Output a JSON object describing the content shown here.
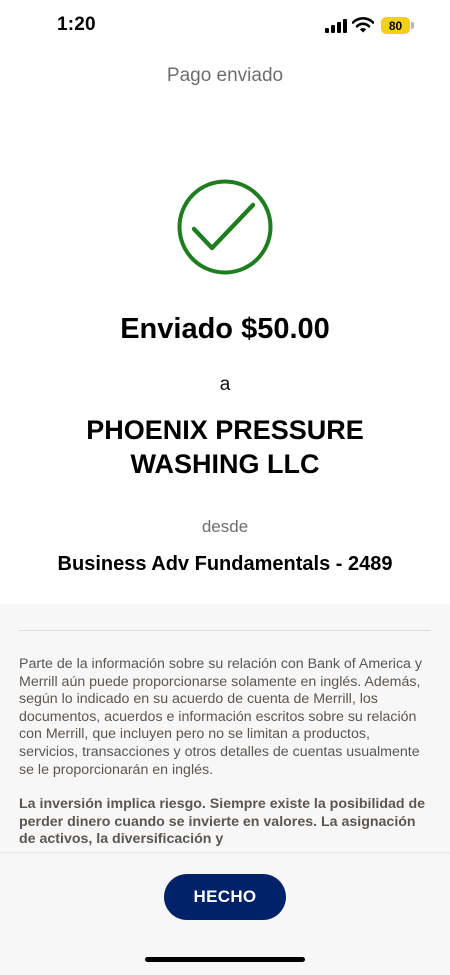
{
  "status_bar": {
    "time": "1:20",
    "battery_level": "80",
    "signal_icon": "cellular-signal-icon",
    "wifi_icon": "wifi-icon",
    "battery_color": "#f4d117"
  },
  "header": {
    "title": "Pago enviado"
  },
  "confirmation": {
    "icon": "checkmark-circle-icon",
    "icon_color": "#1e7d1e",
    "sent_label": "Enviado $50.00",
    "to_word": "a",
    "recipient_line1": "PHOENIX PRESSURE",
    "recipient_line2": "WASHING LLC",
    "from_word": "desde",
    "account": "Business Adv Fundamentals - 2489"
  },
  "disclosure": {
    "paragraph": "Parte de la información sobre su relación con Bank of America y Merrill aún puede proporcionarse solamente en inglés. Además, según lo indicado en su acuerdo de cuenta de Merrill, los documentos, acuerdos e información escritos sobre su relación con Merrill, que incluyen pero no se limitan a productos, servicios, transacciones y otros detalles de cuentas usualmente se le proporcionarán en inglés.",
    "risk_paragraph": "La inversión implica riesgo. Siempre existe la posibilidad de perder dinero cuando se invierte en valores. La asignación de activos, la diversificación y"
  },
  "footer": {
    "done_label": "HECHO",
    "done_color": "#012169"
  }
}
